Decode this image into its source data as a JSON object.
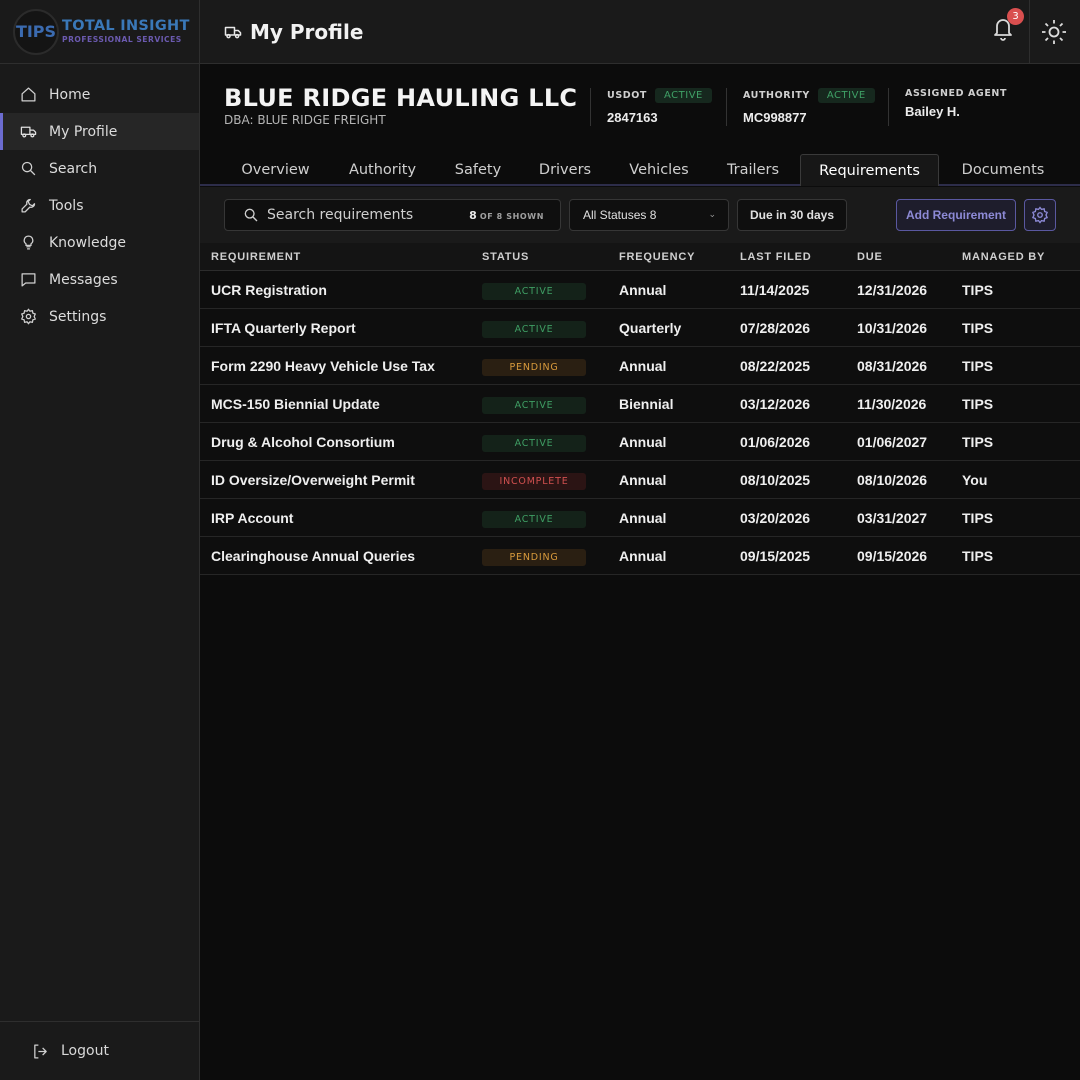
{
  "logo": {
    "mark": "TIPS",
    "line1": "TOTAL INSIGHT",
    "line2": "PROFESSIONAL SERVICES"
  },
  "nav": {
    "items": [
      {
        "label": "Home",
        "icon": "home-icon"
      },
      {
        "label": "My Profile",
        "icon": "truck-icon",
        "active": true
      },
      {
        "label": "Search",
        "icon": "search-icon"
      },
      {
        "label": "Tools",
        "icon": "wrench-icon"
      },
      {
        "label": "Knowledge",
        "icon": "lightbulb-icon"
      },
      {
        "label": "Messages",
        "icon": "message-icon"
      },
      {
        "label": "Settings",
        "icon": "gear-icon"
      }
    ],
    "logout": "Logout"
  },
  "topbar": {
    "title": "My Profile",
    "notification_count": "3"
  },
  "company": {
    "name": "BLUE RIDGE HAULING LLC",
    "dba": "DBA: BLUE RIDGE FREIGHT",
    "usdot": {
      "label": "USDOT",
      "status": "ACTIVE",
      "value": "2847163"
    },
    "authority": {
      "label": "AUTHORITY",
      "status": "ACTIVE",
      "value": "MC998877"
    },
    "agent": {
      "label": "ASSIGNED AGENT",
      "value": "Bailey H."
    }
  },
  "tabs": [
    "Overview",
    "Authority",
    "Safety",
    "Drivers",
    "Vehicles",
    "Trailers",
    "Requirements",
    "Documents"
  ],
  "active_tab": "Requirements",
  "toolbar": {
    "search_placeholder": "Search requirements",
    "shown_count": "8",
    "shown_suffix": "OF 8 SHOWN",
    "status_filter": "All Statuses 8",
    "due_filter": "Due in 30 days",
    "add_label": "Add Requirement"
  },
  "table": {
    "headers": [
      "REQUIREMENT",
      "STATUS",
      "FREQUENCY",
      "LAST FILED",
      "DUE",
      "MANAGED BY"
    ],
    "rows": [
      {
        "requirement": "UCR Registration",
        "status": "ACTIVE",
        "frequency": "Annual",
        "last_filed": "11/14/2025",
        "due": "12/31/2026",
        "managed_by": "TIPS"
      },
      {
        "requirement": "IFTA Quarterly Report",
        "status": "ACTIVE",
        "frequency": "Quarterly",
        "last_filed": "07/28/2026",
        "due": "10/31/2026",
        "managed_by": "TIPS"
      },
      {
        "requirement": "Form 2290 Heavy Vehicle Use Tax",
        "status": "PENDING",
        "frequency": "Annual",
        "last_filed": "08/22/2025",
        "due": "08/31/2026",
        "managed_by": "TIPS"
      },
      {
        "requirement": "MCS-150 Biennial Update",
        "status": "ACTIVE",
        "frequency": "Biennial",
        "last_filed": "03/12/2026",
        "due": "11/30/2026",
        "managed_by": "TIPS"
      },
      {
        "requirement": "Drug & Alcohol Consortium",
        "status": "ACTIVE",
        "frequency": "Annual",
        "last_filed": "01/06/2026",
        "due": "01/06/2027",
        "managed_by": "TIPS"
      },
      {
        "requirement": "ID Oversize/Overweight Permit",
        "status": "INCOMPLETE",
        "frequency": "Annual",
        "last_filed": "08/10/2025",
        "due": "08/10/2026",
        "managed_by": "You"
      },
      {
        "requirement": "IRP Account",
        "status": "ACTIVE",
        "frequency": "Annual",
        "last_filed": "03/20/2026",
        "due": "03/31/2027",
        "managed_by": "TIPS"
      },
      {
        "requirement": "Clearinghouse Annual Queries",
        "status": "PENDING",
        "frequency": "Annual",
        "last_filed": "09/15/2025",
        "due": "09/15/2026",
        "managed_by": "TIPS"
      }
    ]
  },
  "colors": {
    "accent": "#6c6cd0",
    "active": "#3f9e64",
    "pending": "#d89a3c",
    "incomplete": "#d0504f"
  }
}
